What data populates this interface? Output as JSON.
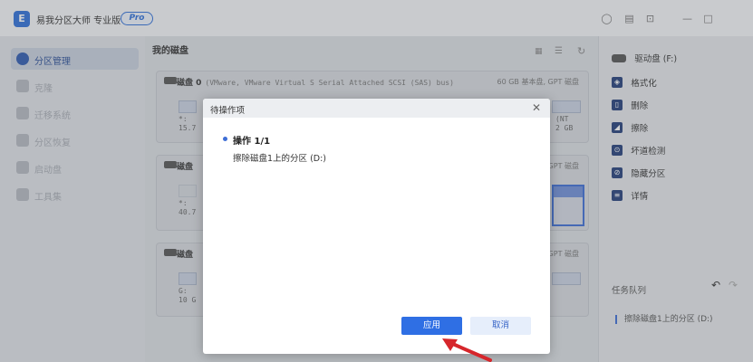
{
  "app": {
    "title": "易我分区大师 专业版",
    "badge": "Pro",
    "logo_glyph": "E"
  },
  "window_controls": [
    {
      "name": "user-icon",
      "glyph": "◯"
    },
    {
      "name": "feedback-icon",
      "glyph": "▤"
    },
    {
      "name": "restore-icon",
      "glyph": "⊡"
    },
    {
      "name": "minimize-icon",
      "glyph": "—"
    },
    {
      "name": "maximize-icon",
      "glyph": "□"
    }
  ],
  "sidebar": {
    "items": [
      {
        "label": "分区管理",
        "active": true
      },
      {
        "label": "克隆",
        "active": false
      },
      {
        "label": "迁移系统",
        "active": false
      },
      {
        "label": "分区恢复",
        "active": false
      },
      {
        "label": "启动盘",
        "active": false
      },
      {
        "label": "工具集",
        "active": false
      }
    ]
  },
  "main": {
    "title": "我的磁盘",
    "disks": [
      {
        "name": "磁盘 0",
        "detail": "(VMware, VMware Virtual S Serial Attached SCSI (SAS) bus)",
        "meta": "60 GB 基本盘, GPT 磁盘",
        "part_lines": [
          "*: ",
          "15.7"
        ],
        "right_lines": [
          "(NT",
          "2 GB"
        ]
      },
      {
        "name": "磁盘",
        "detail": "",
        "meta": "GPT 磁盘",
        "part_lines": [
          "*: ",
          "40.7"
        ],
        "right_lines": []
      },
      {
        "name": "磁盘",
        "detail": "",
        "meta": "GPT 磁盘",
        "part_lines": [
          "G: ",
          "10 G"
        ],
        "right_lines": []
      }
    ]
  },
  "right_panel": {
    "drive_label": "驱动盘 (F:)",
    "actions": [
      {
        "label": "格式化",
        "icon": "format-icon"
      },
      {
        "label": "删除",
        "icon": "trash-icon"
      },
      {
        "label": "擦除",
        "icon": "eraser-icon"
      },
      {
        "label": "坏道检测",
        "icon": "scan-icon"
      },
      {
        "label": "隐藏分区",
        "icon": "hide-icon"
      },
      {
        "label": "详情",
        "icon": "detail-icon"
      }
    ],
    "task_queue_title": "任务队列",
    "task_items": [
      "擦除磁盘1上的分区 (D:)"
    ]
  },
  "modal": {
    "title": "待操作项",
    "op_title": "操作 1/1",
    "op_desc": "擦除磁盘1上的分区 (D:)",
    "apply_label": "应用",
    "cancel_label": "取消"
  },
  "colors": {
    "accent": "#2f6fe4",
    "arrow": "#d6262b"
  }
}
